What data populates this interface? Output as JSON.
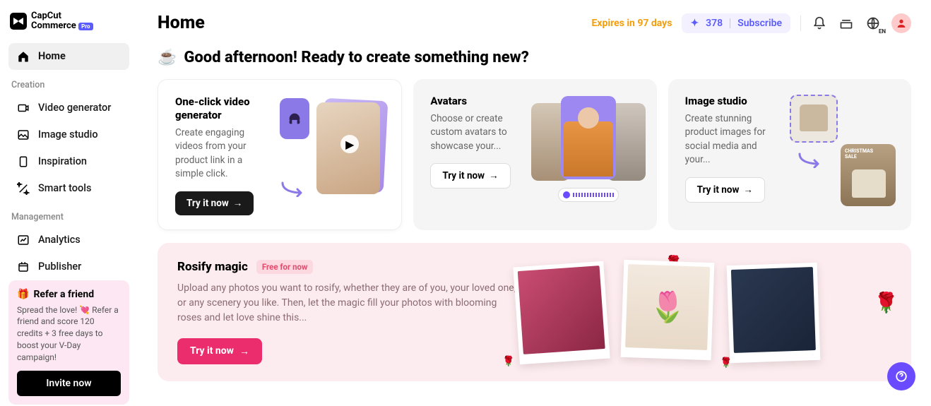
{
  "logo": {
    "line1": "CapCut",
    "line2": "Commerce",
    "badge": "Pro"
  },
  "sidebar": {
    "home": "Home",
    "sections": {
      "creation": "Creation",
      "creation_items": [
        "Video generator",
        "Image studio",
        "Inspiration",
        "Smart tools"
      ],
      "management": "Management",
      "management_items": [
        "Analytics",
        "Publisher"
      ]
    },
    "refer": {
      "title": "Refer a friend",
      "text": "Spread the love! 💘 Refer a friend and score 120 credits + 3 free days to boost your V-Day campaign!",
      "button": "Invite now"
    }
  },
  "topbar": {
    "title": "Home",
    "expires": "Expires in 97 days",
    "credits": "378",
    "subscribe": "Subscribe",
    "lang": "EN"
  },
  "greeting": "Good afternoon! Ready to create something new?",
  "cards": [
    {
      "title": "One-click video generator",
      "desc": "Create engaging videos from your product link in a simple click.",
      "cta": "Try it now"
    },
    {
      "title": "Avatars",
      "desc": "Choose or create custom avatars to showcase your...",
      "cta": "Try it now"
    },
    {
      "title": "Image studio",
      "desc": "Create stunning product images for social media and your...",
      "cta": "Try it now"
    }
  ],
  "rosify": {
    "title": "Rosify magic",
    "badge": "Free for now",
    "desc": "Upload any photos you want to rosify, whether they are of you, your loved one, or any scenery you like. Then, let the magic fill your photos with blooming roses and let love shine this...",
    "cta": "Try it now"
  }
}
